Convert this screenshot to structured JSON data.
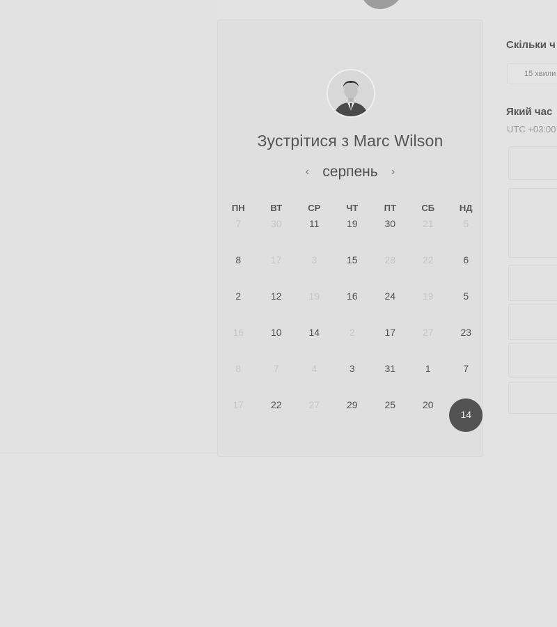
{
  "meeting": {
    "title": "Зустрітися з Marc Wilson"
  },
  "calendar": {
    "month": "серпень",
    "prev_icon": "‹",
    "next_icon": "›",
    "weekdays": [
      "ПН",
      "ВТ",
      "СР",
      "ЧТ",
      "ПТ",
      "СБ",
      "НД"
    ],
    "weeks": [
      [
        "7",
        "30",
        "11",
        "19",
        "30",
        "21",
        "5"
      ],
      [
        "8",
        "17",
        "3",
        "15",
        "28",
        "22",
        "6"
      ],
      [
        "2",
        "12",
        "19",
        "16",
        "24",
        "19",
        "5"
      ],
      [
        "16",
        "10",
        "14",
        "2",
        "17",
        "27",
        "23"
      ],
      [
        "8",
        "7",
        "4",
        "3",
        "31",
        "1",
        "7"
      ],
      [
        "17",
        "22",
        "27",
        "29",
        "25",
        "20",
        "14"
      ]
    ],
    "selected_day": "14"
  },
  "sidebar": {
    "duration_heading": "Скільки ч",
    "duration_option": "15 хвили",
    "time_heading": "Який час",
    "timezone": "UTC +03:00"
  },
  "colors": {
    "background": "#e3e3e3",
    "selected_day_bg": "#535353",
    "inactive_day": "#c6c6c6"
  }
}
